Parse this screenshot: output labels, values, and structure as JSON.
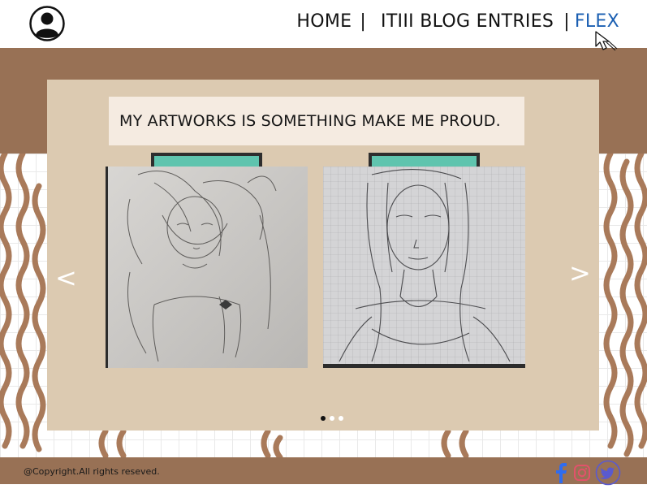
{
  "header": {
    "avatar_icon": "user-circle-icon",
    "nav": [
      {
        "label": "HOME",
        "active": false
      },
      {
        "label": "ITIII BLOG ENTRIES",
        "active": false
      },
      {
        "label": "FLEX",
        "active": true
      }
    ],
    "separator": "|",
    "cursor_icon": "mouse-pointer-icon"
  },
  "colors": {
    "brown": "#987155",
    "panel": "#dccab1",
    "banner": "#f5ebe1",
    "tab": "#5fc4ae",
    "active_link": "#1b5fb2",
    "squiggle": "#a97a5a"
  },
  "gallery": {
    "heading": "MY ARTWORKS IS SOMETHING MAKE ME PROUD.",
    "prev_label": "<",
    "next_label": ">",
    "slides": [
      {
        "subject": "pencil-sketch-anime-girl-arms-raised"
      },
      {
        "subject": "pencil-sketch-anime-girl-headband-grid-paper"
      }
    ],
    "dots": 3,
    "active_dot": 0
  },
  "footer": {
    "copyright": "@Copyright.All rights reseved.",
    "socials": [
      "facebook-icon",
      "instagram-icon",
      "twitter-icon"
    ]
  }
}
